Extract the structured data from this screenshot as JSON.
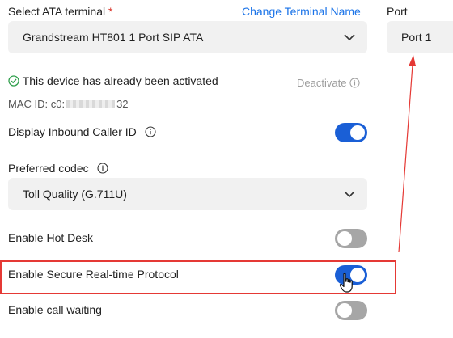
{
  "ata": {
    "label": "Select ATA terminal",
    "required_mark": "*",
    "change_link": "Change Terminal Name",
    "selected": "Grandstream HT801 1 Port SIP ATA"
  },
  "port": {
    "label": "Port",
    "selected": "Port 1"
  },
  "activation": {
    "status": "This device has already been activated",
    "deactivate": "Deactivate",
    "mac_prefix": "MAC ID: c0:",
    "mac_suffix": "32"
  },
  "settings": {
    "inbound_caller_id": {
      "label": "Display Inbound Caller ID",
      "on": true
    },
    "codec_label": "Preferred codec",
    "codec_value": "Toll Quality (G.711U)",
    "hot_desk": {
      "label": "Enable Hot Desk",
      "on": false
    },
    "srtp": {
      "label": "Enable Secure Real-time Protocol",
      "on": true
    },
    "call_waiting": {
      "label": "Enable call waiting",
      "on": false
    }
  },
  "colors": {
    "accent": "#1a5fd6",
    "link": "#1a73e8",
    "toggle_off": "#a6a6a6",
    "highlight": "#e53935",
    "success": "#2e9e4a"
  },
  "icons": {
    "chevron": "chevron-down-icon",
    "info": "info-icon",
    "check": "check-circle-icon",
    "cursor": "hand-pointer-icon"
  }
}
